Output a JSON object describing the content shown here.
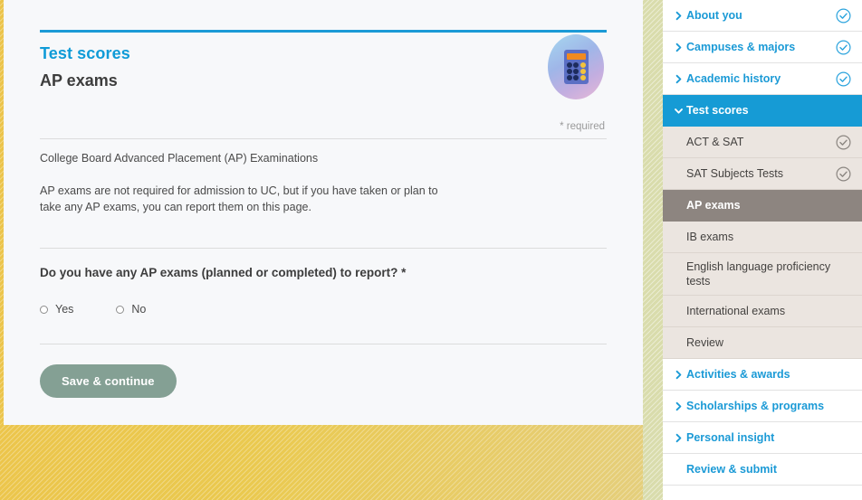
{
  "theme": {
    "accent_blue": "#169bd5",
    "link_blue": "#1b9ad6",
    "active_sub_bg": "#8d8580",
    "sub_bg": "#ebe5e0",
    "button_green": "#84a094",
    "page_bg_gold": "#eac94f"
  },
  "main": {
    "eyebrow": "Test scores",
    "title": "AP exams",
    "badge_icon": "calculator-icon",
    "required_note": "* required",
    "intro_line": "College Board Advanced Placement (AP) Examinations",
    "paragraph": "AP exams are not required for admission to UC, but if you have taken or plan to take any AP exams, you can report them on this page.",
    "question": "Do you have any AP exams (planned or completed) to report? *",
    "radio_options": [
      {
        "label": "Yes",
        "value": "yes",
        "checked": false
      },
      {
        "label": "No",
        "value": "no",
        "checked": false
      }
    ],
    "save_button": "Save & continue"
  },
  "sidebar": {
    "items": [
      {
        "label": "About you",
        "level": 1,
        "state": "link",
        "chevron": "chevron-right-icon",
        "check": "check-circle-blue"
      },
      {
        "label": "Campuses & majors",
        "level": 1,
        "state": "link",
        "chevron": "chevron-right-icon",
        "check": "check-circle-blue"
      },
      {
        "label": "Academic history",
        "level": 1,
        "state": "link",
        "chevron": "chevron-right-icon",
        "check": "check-circle-blue"
      },
      {
        "label": "Test scores",
        "level": 1,
        "state": "active",
        "chevron": "chevron-down-icon",
        "check": "none"
      },
      {
        "label": "ACT & SAT",
        "level": 2,
        "state": "sub",
        "chevron": "none",
        "check": "check-circle-gray"
      },
      {
        "label": "SAT Subjects Tests",
        "level": 2,
        "state": "sub",
        "chevron": "none",
        "check": "check-circle-gray"
      },
      {
        "label": "AP exams",
        "level": 2,
        "state": "current",
        "chevron": "none",
        "check": "none"
      },
      {
        "label": "IB exams",
        "level": 2,
        "state": "sub",
        "chevron": "none",
        "check": "none"
      },
      {
        "label": "English language proficiency tests",
        "level": 2,
        "state": "sub",
        "chevron": "none",
        "check": "none"
      },
      {
        "label": "International exams",
        "level": 2,
        "state": "sub",
        "chevron": "none",
        "check": "none"
      },
      {
        "label": "Review",
        "level": 2,
        "state": "sub",
        "chevron": "none",
        "check": "none"
      },
      {
        "label": "Activities & awards",
        "level": 1,
        "state": "link",
        "chevron": "chevron-right-icon",
        "check": "none"
      },
      {
        "label": "Scholarships & programs",
        "level": 1,
        "state": "link",
        "chevron": "chevron-right-icon",
        "check": "none"
      },
      {
        "label": "Personal insight",
        "level": 1,
        "state": "link",
        "chevron": "chevron-right-icon",
        "check": "none"
      },
      {
        "label": "Review & submit",
        "level": 1,
        "state": "link",
        "chevron": "none",
        "check": "none"
      }
    ]
  }
}
